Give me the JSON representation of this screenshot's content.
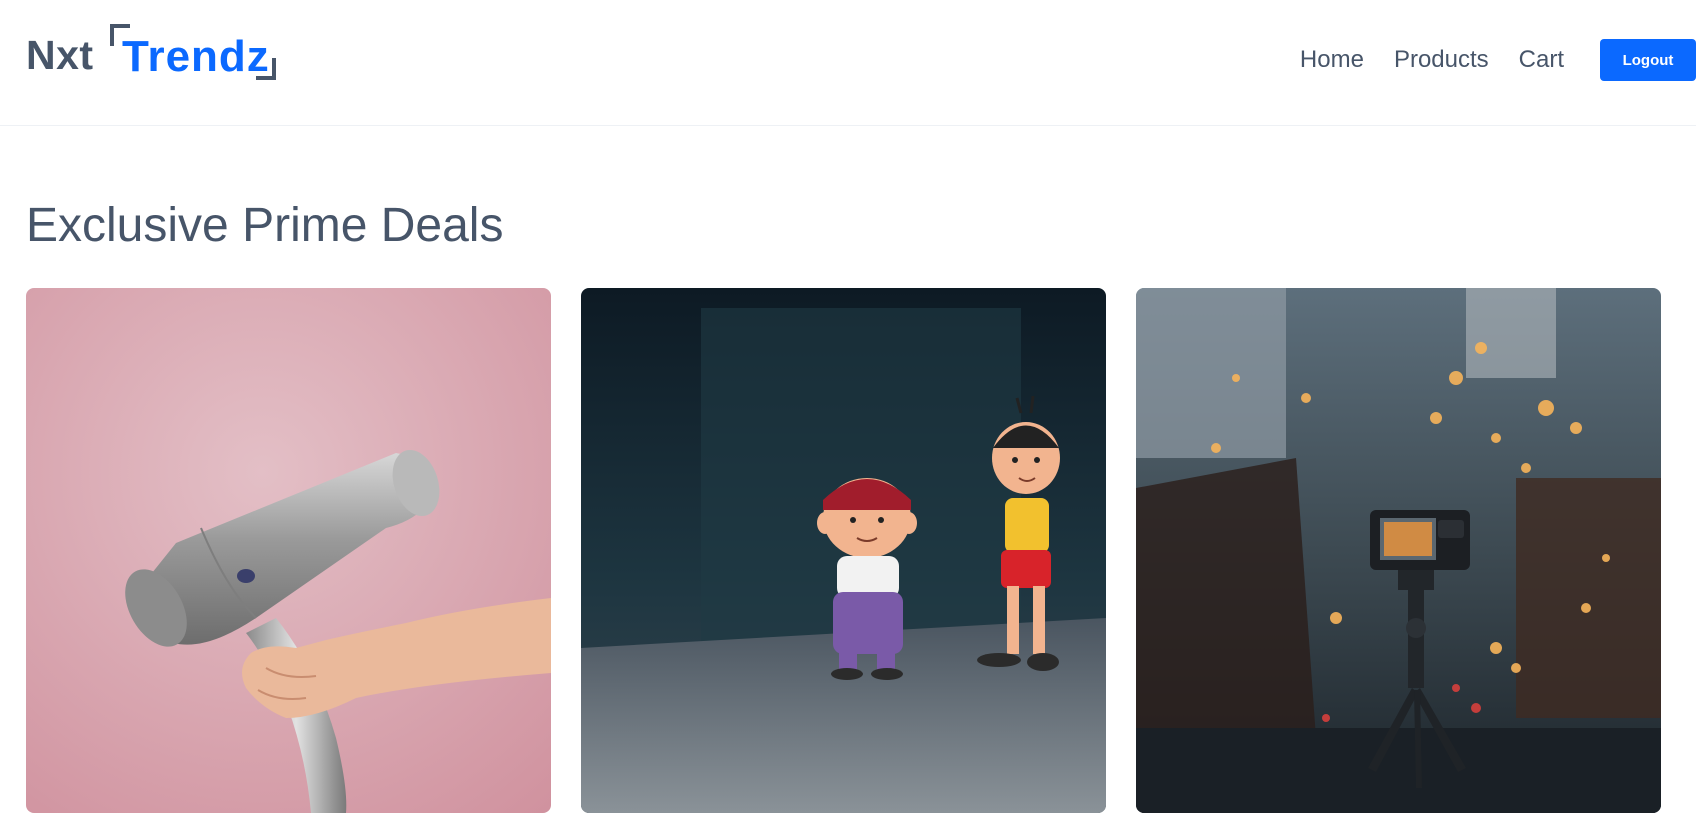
{
  "brand": {
    "prefix": "Nxt",
    "name": "Trendz"
  },
  "nav": {
    "links": [
      "Home",
      "Products",
      "Cart"
    ],
    "logout_label": "Logout"
  },
  "section": {
    "title": "Exclusive Prime Deals"
  },
  "colors": {
    "accent": "#0b69ff",
    "text": "#475569"
  },
  "deals": [
    {
      "icon": "hair-dryer-image"
    },
    {
      "icon": "toy-figures-image"
    },
    {
      "icon": "camera-tripod-image"
    }
  ]
}
